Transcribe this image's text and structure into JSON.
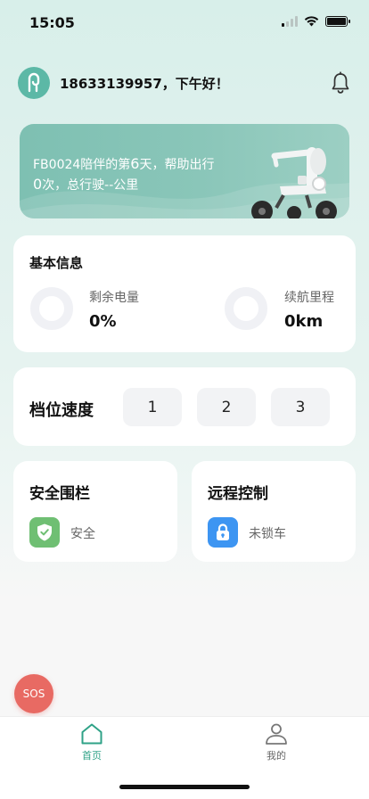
{
  "status_bar": {
    "time": "15:05"
  },
  "header": {
    "greeting": "18633139957，下午好！",
    "avatar_icon": "app-logo-icon",
    "bell_icon": "bell-icon"
  },
  "banner": {
    "line1_prefix": "FB0024陪伴的第",
    "days": "6",
    "line1_suffix": "天，帮助出行",
    "trips": "0",
    "line2_suffix": "次，总行驶--公里",
    "image_icon": "wheelchair-icon"
  },
  "basic_info": {
    "title": "基本信息",
    "battery_label": "剩余电量",
    "battery_value": "0%",
    "battery_level": 0,
    "range_label": "续航里程",
    "range_value": "0km"
  },
  "gear": {
    "title": "档位速度",
    "options": [
      "1",
      "2",
      "3"
    ]
  },
  "fence": {
    "title": "安全围栏",
    "status": "安全",
    "icon": "shield-check-icon",
    "icon_color": "#6fbf73"
  },
  "remote": {
    "title": "远程控制",
    "status": "未锁车",
    "icon": "lock-icon",
    "icon_color": "#3d95f2"
  },
  "sos": {
    "label": "SOS",
    "color": "#e86a63"
  },
  "tabbar": {
    "tabs": [
      {
        "label": "首页",
        "icon": "home-icon",
        "active": true
      },
      {
        "label": "我的",
        "icon": "user-icon",
        "active": false
      }
    ],
    "active_color": "#2fa287",
    "inactive_color": "#666666"
  }
}
